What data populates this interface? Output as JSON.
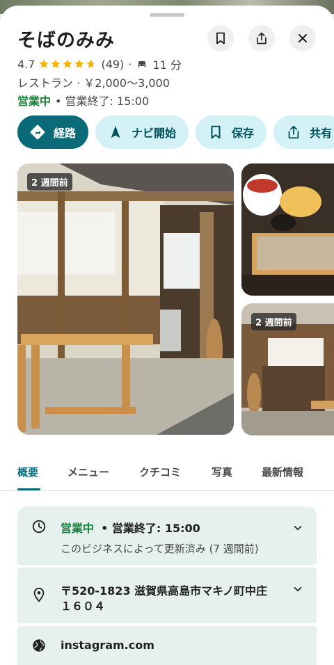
{
  "place": {
    "name": "そばのみみ",
    "rating": "4.7",
    "stars": 4.7,
    "review_count": "(49)",
    "drive_time": "11 分",
    "category_price": "レストラン · ￥2,000～3,000",
    "status_open": "営業中",
    "status_close": "• 営業終了: 15:00"
  },
  "actions": [
    {
      "label": "経路",
      "icon": "directions-icon"
    },
    {
      "label": "ナビ開始",
      "icon": "navigation-arrow-icon"
    },
    {
      "label": "保存",
      "icon": "bookmark-icon"
    },
    {
      "label": "共有",
      "icon": "share-icon"
    }
  ],
  "photos": {
    "main_badge": "2 週間前",
    "side_badge": "2 週間前"
  },
  "tabs": [
    "概要",
    "メニュー",
    "クチコミ",
    "写真",
    "最新情報"
  ],
  "info": {
    "hours_open": "営業中",
    "hours_close": "• 営業終了: 15:00",
    "hours_updated": "このビジネスによって更新済み (7 週間前)",
    "address_line1": "〒520-1823 滋賀県高島市マキノ町中庄",
    "address_line2": "１６０４",
    "website": "instagram.com"
  },
  "colors": {
    "accent": "#0b6a78",
    "chip_bg": "#d4f1f8",
    "open_green": "#188038",
    "star": "#f4b400",
    "info_bg": "#e6f0ee"
  }
}
